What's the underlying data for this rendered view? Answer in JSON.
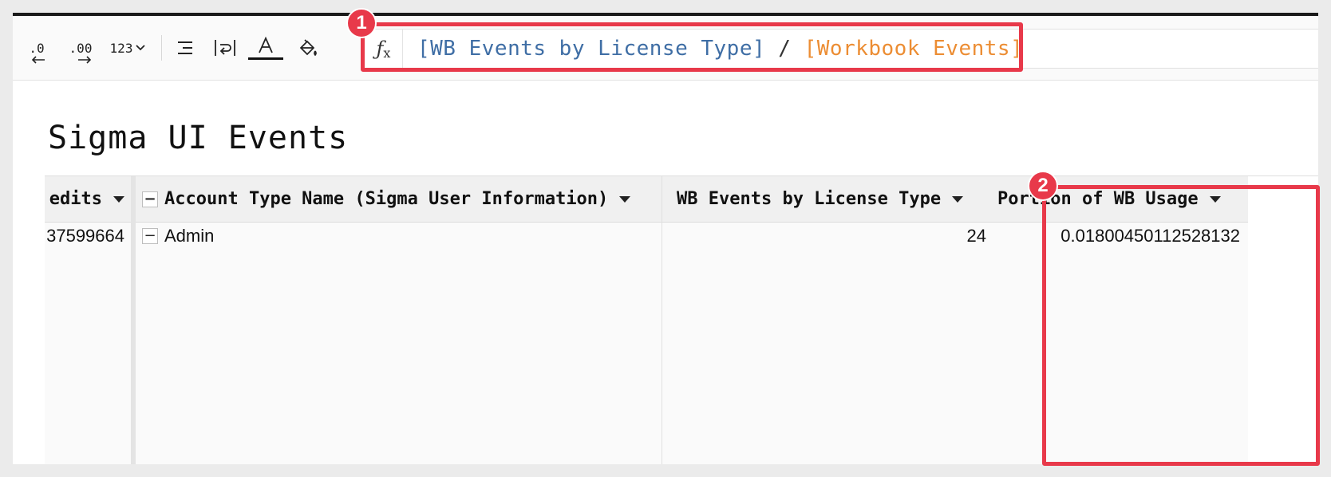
{
  "toolbar": {
    "decrease_decimals": ".0",
    "increase_decimals": ".00",
    "number_format": "123"
  },
  "formula": {
    "fx": "fx",
    "ref1": "[WB Events by License Type]",
    "operator": "/",
    "ref2": "[Workbook Events]"
  },
  "title": "Sigma UI Events",
  "table": {
    "columns": [
      {
        "header": "edits",
        "value": "37599664"
      },
      {
        "header": "Account Type Name (Sigma User Information)",
        "value": "Admin"
      },
      {
        "header": "WB Events by License Type",
        "value": "24"
      },
      {
        "header": "Portion of WB Usage",
        "value": "0.01800450112528132"
      }
    ]
  },
  "callouts": {
    "badge1": "1",
    "badge2": "2"
  },
  "colors": {
    "callout": "#e8394a",
    "ref_blue": "#3f6ea5",
    "ref_orange": "#ec8d33"
  }
}
